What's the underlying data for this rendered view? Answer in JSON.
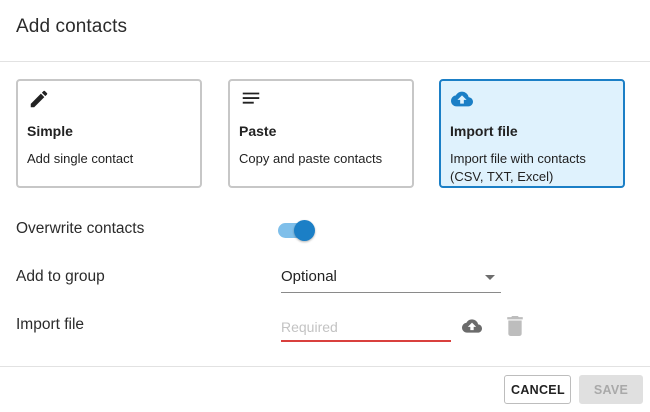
{
  "dialog": {
    "title": "Add contacts"
  },
  "cards": [
    {
      "icon": "pencil-icon",
      "title": "Simple",
      "description": "Add single contact",
      "selected": false
    },
    {
      "icon": "lines-icon",
      "title": "Paste",
      "description": "Copy and paste contacts",
      "selected": false
    },
    {
      "icon": "cloud-upload-icon",
      "title": "Import file",
      "description": "Import file with contacts (CSV, TXT, Excel)",
      "selected": true
    }
  ],
  "form": {
    "overwrite": {
      "label": "Overwrite contacts",
      "checked": true
    },
    "group": {
      "label": "Add to group",
      "value": "Optional"
    },
    "import": {
      "label": "Import file",
      "placeholder": "Required",
      "value": ""
    }
  },
  "footer": {
    "cancel_label": "CANCEL",
    "save_label": "SAVE"
  },
  "colors": {
    "accent": "#1b7fc6",
    "selected_card_bg": "#dff2fd",
    "error_underline": "#d9403d",
    "disabled_button_bg": "#e0e0e0"
  }
}
